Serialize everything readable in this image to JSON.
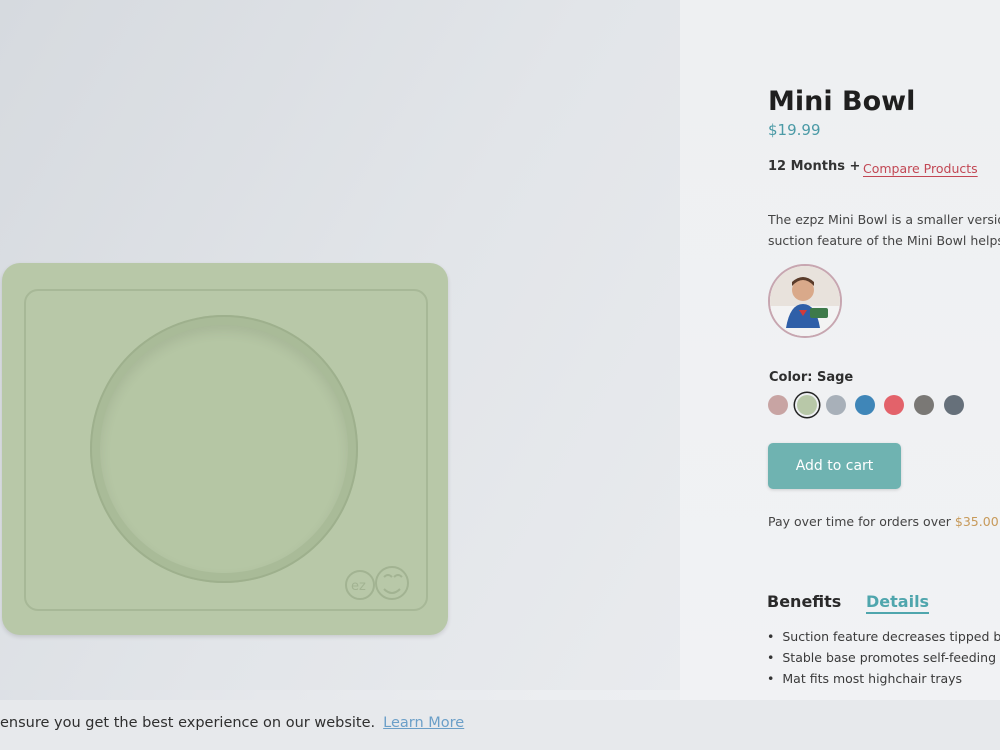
{
  "product": {
    "title": "Mini Bowl",
    "price": "$19.99",
    "age": "12 Months +",
    "compare_label": "Compare Products",
    "description_lines": [
      "The ezpz Mini Bowl is a smaller version",
      "suction feature of the Mini Bowl helps"
    ]
  },
  "image": {
    "logo_text": "ez",
    "mat_color": "#b8c8a8",
    "thumbnail_icon": "child-photo-thumbnail"
  },
  "color_selector": {
    "label": "Color: Sage",
    "selected": "Sage",
    "swatches": [
      {
        "color": "#c8a4a3"
      },
      {
        "color": "#b8c8a8",
        "selected": true
      },
      {
        "color": "#a8b0b9"
      },
      {
        "color": "#3f86b8"
      },
      {
        "color": "#e3626a"
      },
      {
        "color": "#7a7875"
      },
      {
        "color": "#66707a"
      }
    ]
  },
  "cart": {
    "button_label": "Add to cart",
    "pay_text": "Pay over time for orders over ",
    "pay_amount": "$35.00"
  },
  "tabs": {
    "benefits_label": "Benefits",
    "details_label": "Details"
  },
  "benefits": [
    "Suction feature decreases tipped bowls",
    "Stable base promotes self-feeding",
    "Mat fits most highchair trays"
  ],
  "cookie": {
    "text": "ensure you get the best experience on our website.",
    "link_label": "Learn More"
  },
  "colors": {
    "accent": "#4fa6ad",
    "link_red": "#c24754",
    "button": "#6fb3b1"
  }
}
